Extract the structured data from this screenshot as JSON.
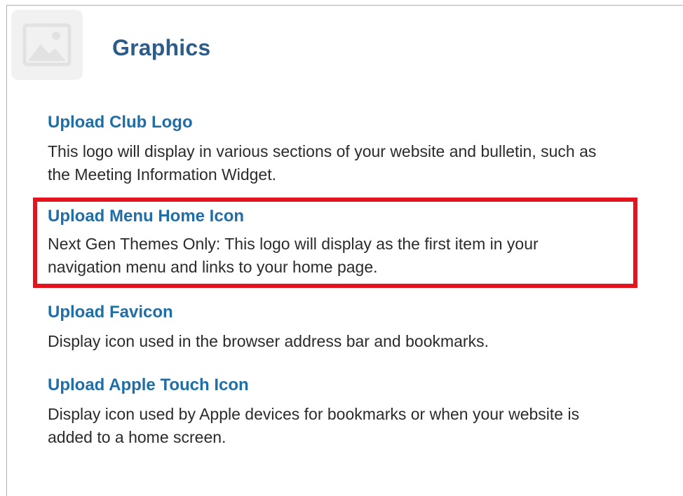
{
  "header": {
    "title": "Graphics",
    "icon": "image-icon"
  },
  "sections": [
    {
      "link": "Upload Club Logo",
      "desc": [
        "This logo will display in various sections of your website and bulletin, such as",
        "the Meeting Information Widget."
      ]
    },
    {
      "link": "Upload Menu Home Icon",
      "desc": [
        "Next Gen Themes Only: This logo will display as the first item in your",
        "navigation menu and links to your home page."
      ]
    },
    {
      "link": "Upload Favicon",
      "desc": [
        "Display icon used in the browser address bar and bookmarks."
      ]
    },
    {
      "link": "Upload Apple Touch Icon",
      "desc": [
        "Display icon used by Apple devices for bookmarks or when your website is",
        "added to a home screen."
      ]
    }
  ],
  "colors": {
    "link": "#1f6ea8",
    "title": "#2e5c88",
    "highlight": "#e3141e"
  }
}
